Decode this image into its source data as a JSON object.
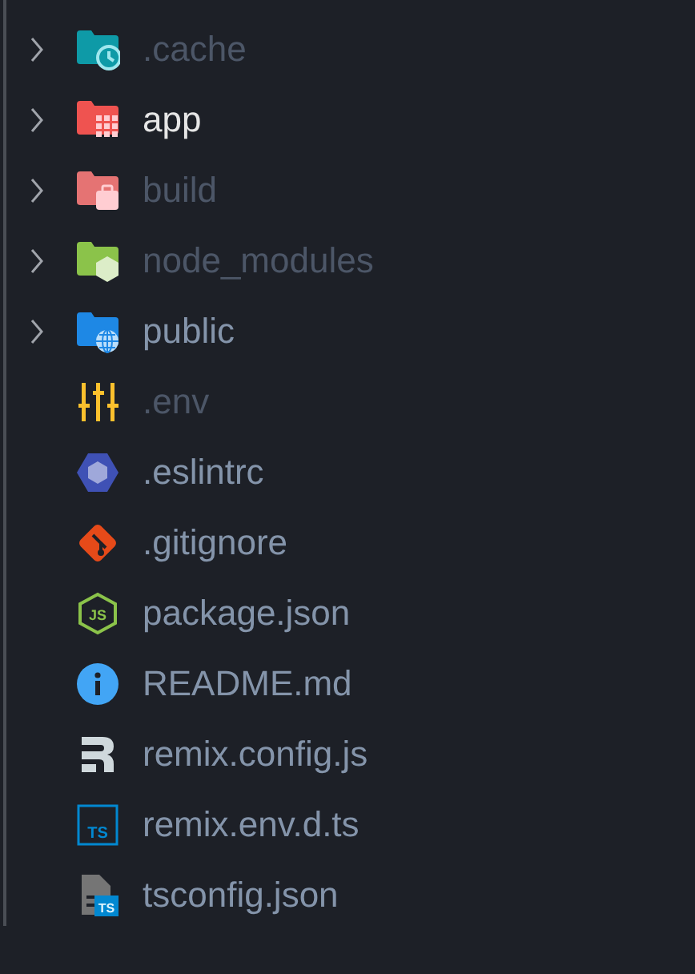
{
  "tree": [
    {
      "name": ".cache",
      "kind": "folder",
      "expanded": false,
      "ignored": true,
      "active": false
    },
    {
      "name": "app",
      "kind": "folder",
      "expanded": false,
      "ignored": false,
      "active": true
    },
    {
      "name": "build",
      "kind": "folder",
      "expanded": false,
      "ignored": true,
      "active": false
    },
    {
      "name": "node_modules",
      "kind": "folder",
      "expanded": false,
      "ignored": true,
      "active": false
    },
    {
      "name": "public",
      "kind": "folder",
      "expanded": false,
      "ignored": false,
      "active": false
    },
    {
      "name": ".env",
      "kind": "file",
      "ignored": true,
      "active": false
    },
    {
      "name": ".eslintrc",
      "kind": "file",
      "ignored": false,
      "active": false
    },
    {
      "name": ".gitignore",
      "kind": "file",
      "ignored": false,
      "active": false
    },
    {
      "name": "package.json",
      "kind": "file",
      "icon_text": "JS",
      "ignored": false,
      "active": false
    },
    {
      "name": "README.md",
      "kind": "file",
      "ignored": false,
      "active": false
    },
    {
      "name": "remix.config.js",
      "kind": "file",
      "ignored": false,
      "active": false
    },
    {
      "name": "remix.env.d.ts",
      "kind": "file",
      "icon_text": "TS",
      "ignored": false,
      "active": false
    },
    {
      "name": "tsconfig.json",
      "kind": "file",
      "icon_text": "TS",
      "ignored": false,
      "active": false
    }
  ]
}
